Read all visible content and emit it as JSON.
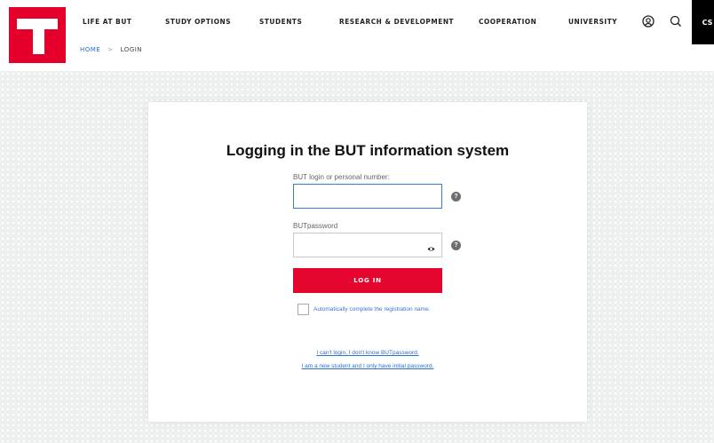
{
  "nav": {
    "items": [
      "LIFE AT BUT",
      "STUDY OPTIONS",
      "STUDENTS",
      "RESEARCH & DEVELOPMENT",
      "COOPERATION",
      "UNIVERSITY"
    ],
    "lang": "CS"
  },
  "breadcrumb": {
    "home": "HOME",
    "separator": ">",
    "current": "LOGIN"
  },
  "form": {
    "title": "Logging in the BUT information system",
    "login_label": "BUT login or personal number:",
    "login_value": "",
    "password_label": "BUTpassword",
    "password_value": "",
    "help_glyph": "?",
    "submit_label": "LOG IN",
    "remember_label": "Automatically complete the registration name.",
    "link_forgot": "I can't login, I don't know BUTpassword.",
    "link_new_student": "I am a new student and I only have initial password."
  },
  "colors": {
    "brand_red": "#e4002b",
    "link_blue": "#2e6fd0",
    "focus_border": "#3b7bd8"
  },
  "icons": [
    "logo-t",
    "user-icon",
    "search-icon",
    "eye-icon",
    "help-icon"
  ]
}
